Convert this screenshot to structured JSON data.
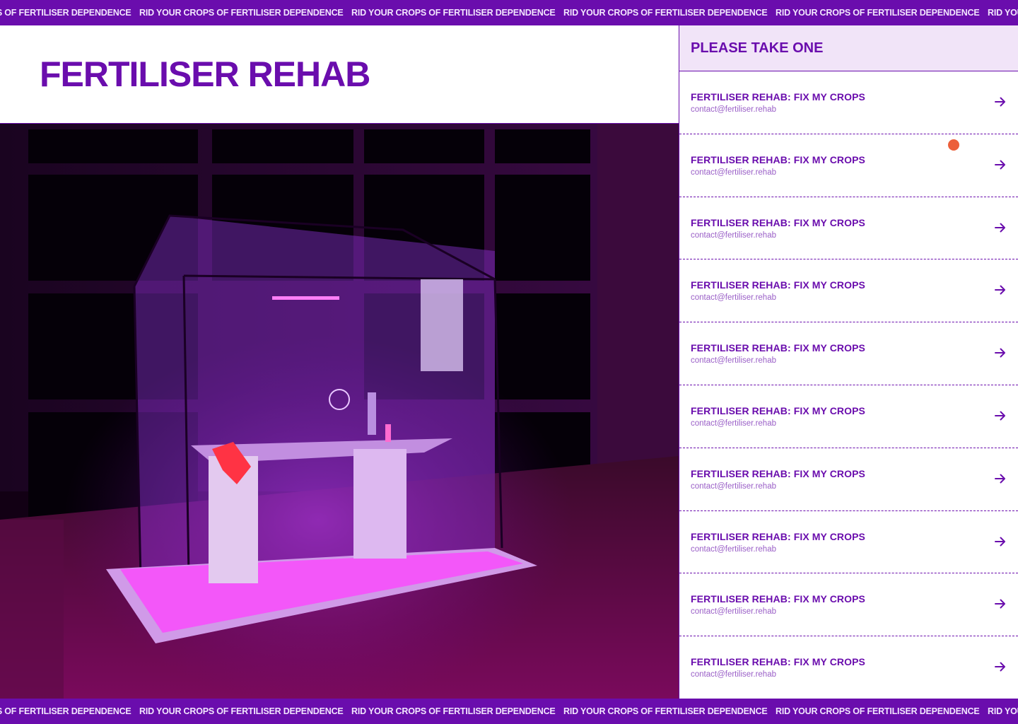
{
  "marquee": {
    "text": "RID YOUR CROPS OF FERTILISER DEPENDENCE",
    "items": [
      "RID YOUR CROPS OF FERTILISER DEPENDENCE",
      "RID YOUR CROPS OF FERTILISER DEPENDENCE",
      "RID YOUR CROPS OF FERTILISER DEPENDENCE",
      "RID YOUR CROPS OF FERTILISER DEPENDENCE",
      "RID YOUR CROPS OF FERTILISER DEPENDENCE",
      "RID YOUR CROPS OF FERTILISER DEPENDENCE"
    ]
  },
  "header": {
    "title": "FERTILISER REHAB"
  },
  "panel": {
    "heading": "PLEASE TAKE ONE",
    "items": [
      {
        "title": "FERTILISER REHAB: FIX MY CROPS",
        "email": "contact@fertiliser.rehab"
      },
      {
        "title": "FERTILISER REHAB: FIX MY CROPS",
        "email": "contact@fertiliser.rehab"
      },
      {
        "title": "FERTILISER REHAB: FIX MY CROPS",
        "email": "contact@fertiliser.rehab"
      },
      {
        "title": "FERTILISER REHAB: FIX MY CROPS",
        "email": "contact@fertiliser.rehab"
      },
      {
        "title": "FERTILISER REHAB: FIX MY CROPS",
        "email": "contact@fertiliser.rehab"
      },
      {
        "title": "FERTILISER REHAB: FIX MY CROPS",
        "email": "contact@fertiliser.rehab"
      },
      {
        "title": "FERTILISER REHAB: FIX MY CROPS",
        "email": "contact@fertiliser.rehab"
      },
      {
        "title": "FERTILISER REHAB: FIX MY CROPS",
        "email": "contact@fertiliser.rehab"
      },
      {
        "title": "FERTILISER REHAB: FIX MY CROPS",
        "email": "contact@fertiliser.rehab"
      },
      {
        "title": "FERTILISER REHAB: FIX MY CROPS",
        "email": "contact@fertiliser.rehab"
      }
    ]
  },
  "icons": {
    "list_arrow": "arrow-right-icon",
    "cursor_dot": "cursor-dot"
  },
  "colors": {
    "brand": "#6a0dad",
    "panel_header_bg": "#f1e4f8",
    "email_text": "#9a5fc7",
    "cursor_dot": "#ec5f3a"
  }
}
